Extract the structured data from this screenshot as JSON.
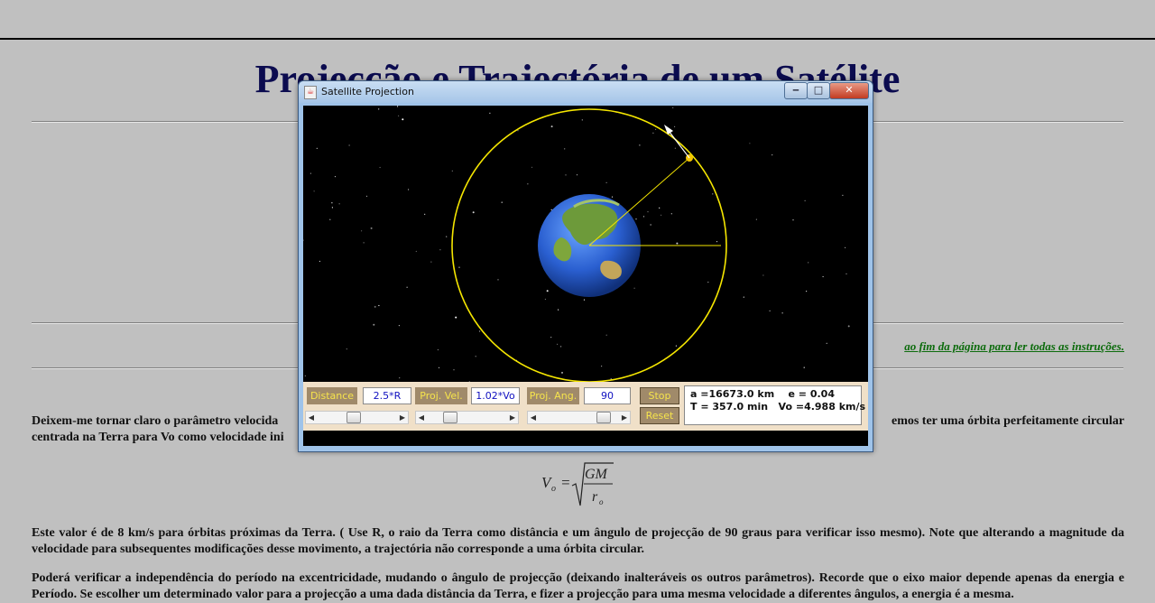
{
  "page": {
    "title": "Projecção e Trajectória de um Satélite",
    "instructions_link": "ao fim da página para ler todas as instruções.",
    "para1_left": "Deixem-me tornar claro o parâmetro velocida",
    "para1_right": "emos ter uma órbita perfeitamente circular",
    "para1_line2": "centrada na Terra para Vo como velocidade ini",
    "formula": {
      "lhs": "V",
      "lhs_sub": "o",
      "eq": "=",
      "num": "GM",
      "den": "r",
      "den_sub": "o"
    },
    "para2": "Este valor é de 8 km/s para órbitas próximas da Terra. ( Use R, o raio da Terra como distância e um ângulo de projecção de 90 graus para verificar isso mesmo). Note que alterando a magnitude da velocidade para subsequentes modificações desse movimento, a trajectória não corresponde a uma órbita circular.",
    "para3": "Poderá verificar a independência do período na excentricidade, mudando o ângulo de projecção (deixando inalteráveis os outros parâmetros). Recorde que o eixo maior depende apenas da energia e Período. Se escolher um determinado valor para a projecção a uma dada distância da Terra, e fizer a projecção para uma mesma velocidade a diferentes ângulos, a energia é a mesma."
  },
  "window": {
    "title": "Satellite Projection",
    "icon": "java-icon",
    "min": "minimize-icon",
    "max": "maximize-icon",
    "close": "close-icon"
  },
  "controls": {
    "distance_label": "Distance",
    "distance_value": "2.5*R",
    "velocity_label": "Proj. Vel.",
    "velocity_value": "1.02*Vo",
    "angle_label": "Proj. Ang.",
    "angle_value": "90",
    "stop_label": "Stop",
    "reset_label": "Reset",
    "distance_slider": 0.45,
    "velocity_slider": 0.25,
    "angle_slider": 0.88
  },
  "info": {
    "line1": "a =16673.0 km    e = 0.04",
    "line2": "T = 357.0 min   Vo =4.988 km/s"
  },
  "colors": {
    "orbit": "#f5e600",
    "label_bg": "#a08a6a",
    "label_text": "#f6e44c",
    "title_text": "#0b0b4f",
    "link": "#0c6b0c"
  }
}
